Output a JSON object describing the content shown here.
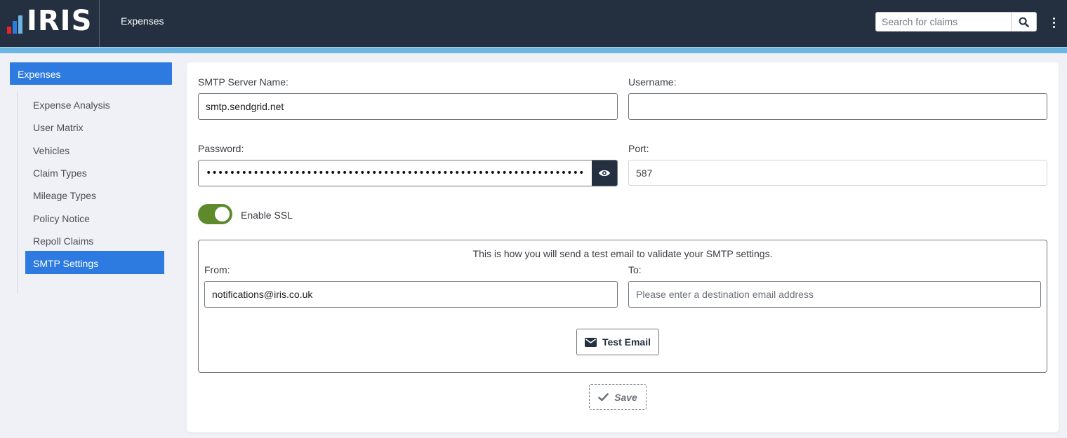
{
  "brand": {
    "name": "IRIS",
    "colors": {
      "bar1": "#e8232a",
      "bar2": "#2d7be0",
      "bar3": "#6cb4e2"
    }
  },
  "header": {
    "app_title": "Expenses",
    "search_placeholder": "Search for claims",
    "search_icon": "search-icon",
    "menu_icon": "more-vertical-icon"
  },
  "sidebar": {
    "section": "Expenses",
    "items": [
      {
        "label": "Expense Analysis"
      },
      {
        "label": "User Matrix"
      },
      {
        "label": "Vehicles"
      },
      {
        "label": "Claim Types"
      },
      {
        "label": "Mileage Types"
      },
      {
        "label": "Policy Notice"
      },
      {
        "label": "Repoll Claims"
      },
      {
        "label": "SMTP Settings",
        "active": true
      }
    ]
  },
  "form": {
    "server_label": "SMTP Server Name:",
    "server_value": "smtp.sendgrid.net",
    "username_label": "Username:",
    "username_value": "",
    "password_label": "Password:",
    "password_mask": "••••••••••••••••••••••••••••••••••••••••••••••••••••••••••••••••••••",
    "port_label": "Port:",
    "port_value": "587",
    "ssl_label": "Enable SSL",
    "ssl_enabled": true
  },
  "test": {
    "note": "This is how you will send a test email to validate your SMTP settings.",
    "from_label": "From:",
    "from_value": "notifications@iris.co.uk",
    "to_label": "To:",
    "to_placeholder": "Please enter a destination email address",
    "button_label": "Test Email"
  },
  "save_label": "Save",
  "colors": {
    "accent": "#2d7be0",
    "header": "#243040",
    "toggle_on": "#5f8a2b"
  }
}
